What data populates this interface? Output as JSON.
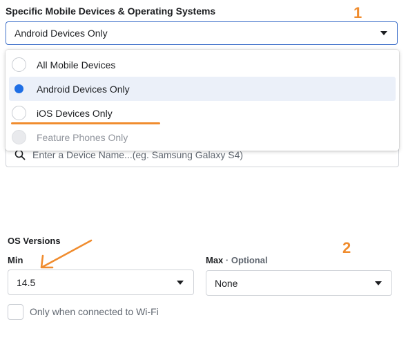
{
  "section_title": "Specific Mobile Devices & Operating Systems",
  "device_select": {
    "value": "Android Devices Only"
  },
  "dropdown": {
    "options": [
      {
        "label": "All Mobile Devices",
        "state": "unselected"
      },
      {
        "label": "Android Devices Only",
        "state": "selected"
      },
      {
        "label": "iOS Devices Only",
        "state": "unselected"
      },
      {
        "label": "Feature Phones Only",
        "state": "disabled"
      }
    ]
  },
  "device_search": {
    "placeholder": "Enter a Device Name...(eg. Samsung Galaxy S4)"
  },
  "os_versions": {
    "title": "OS Versions",
    "min": {
      "label": "Min",
      "value": "14.5"
    },
    "max": {
      "label": "Max",
      "optional": "· Optional",
      "value": "None"
    }
  },
  "wifi_checkbox": {
    "label": "Only when connected to Wi-Fi",
    "checked": false
  },
  "annotations": {
    "one": "1",
    "two": "2"
  },
  "colors": {
    "accent_blue": "#1f6fe5",
    "annotation_orange": "#f08c2e",
    "selected_row": "#ebf0f9"
  }
}
